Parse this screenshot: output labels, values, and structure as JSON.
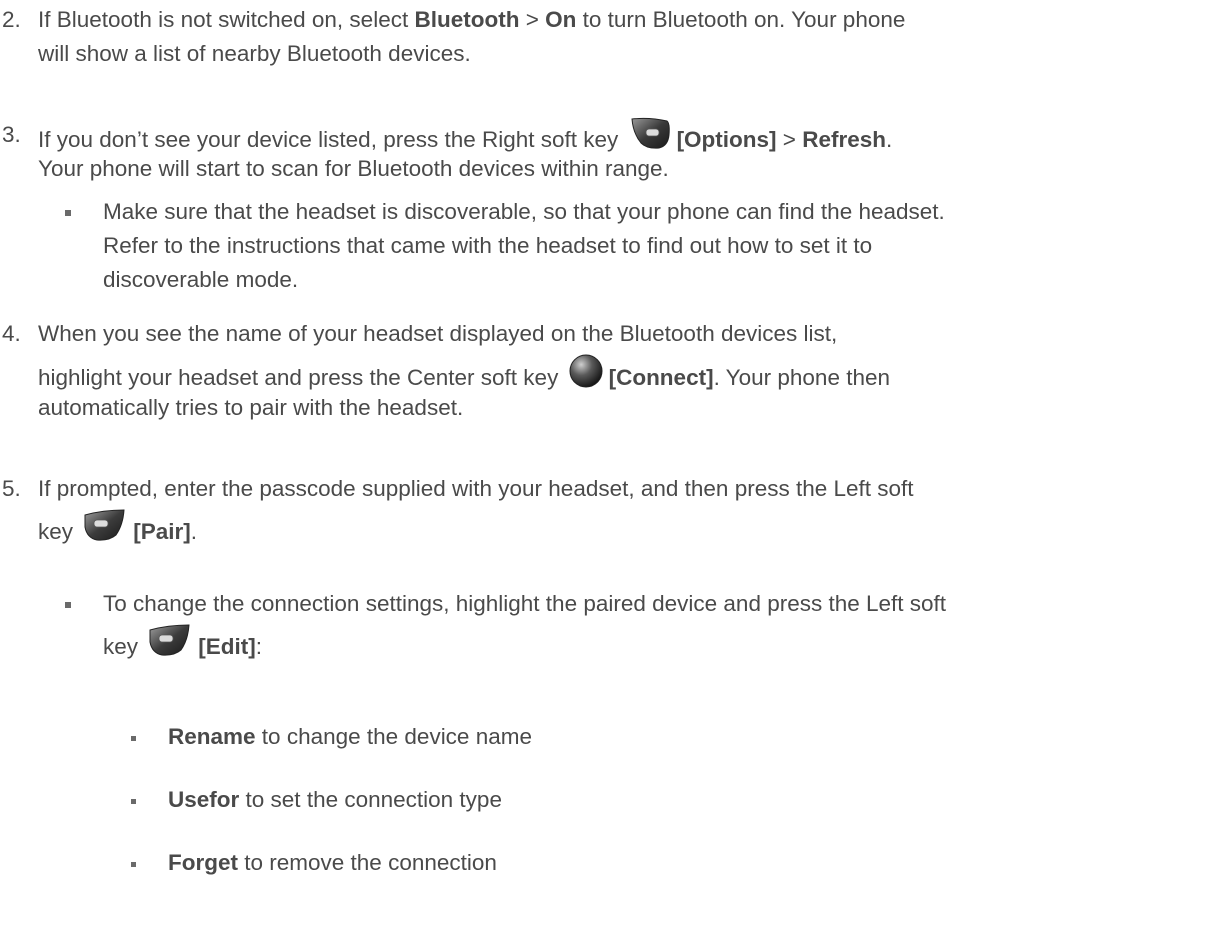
{
  "steps": [
    {
      "num": "2.",
      "a": "If Bluetooth is not switched on, select ",
      "b1": "Bluetooth",
      "c": " > ",
      "b2": "On",
      "d": " to turn Bluetooth on. Your phone",
      "line2": "will show a list of nearby Bluetooth devices."
    },
    {
      "num": "3.",
      "a": "If you don’t see your device listed, press the Right soft key ",
      "key": "[Options]",
      "c": " > ",
      "b2": "Refresh",
      "d": ".",
      "line2": "Your phone will start to scan for Bluetooth devices within range.",
      "icon": "right-soft-key-icon"
    },
    {
      "num": "4.",
      "line1": "When you see the name of your headset displayed on the Bluetooth devices list,",
      "a": "highlight your headset and press the Center soft key ",
      "key": "[Connect]",
      "d": ". Your phone then",
      "line3": "automatically tries to pair with the headset.",
      "icon": "center-soft-key-icon"
    },
    {
      "num": "5.",
      "line1": "If prompted, enter the passcode supplied with your headset, and then press the Left soft",
      "a": "key ",
      "key": "[Pair]",
      "d": ".",
      "icon": "left-soft-key-icon"
    }
  ],
  "bullet1": {
    "line1": "Make sure that the headset is discoverable, so that your phone can find the headset.",
    "line2": "Refer to the instructions that came with the headset to find out how to set it to",
    "line3": "discoverable mode."
  },
  "bullet2": {
    "line1": "To change the connection settings, highlight the paired device and press the Left soft",
    "a": "key ",
    "key": "[Edit]",
    "d": ":"
  },
  "subitems": [
    {
      "bold": "Rename",
      "text": " to change the device name"
    },
    {
      "bold": "Usefor",
      "text": " to set the connection type"
    },
    {
      "bold": "Forget",
      "text": " to remove the connection"
    }
  ]
}
